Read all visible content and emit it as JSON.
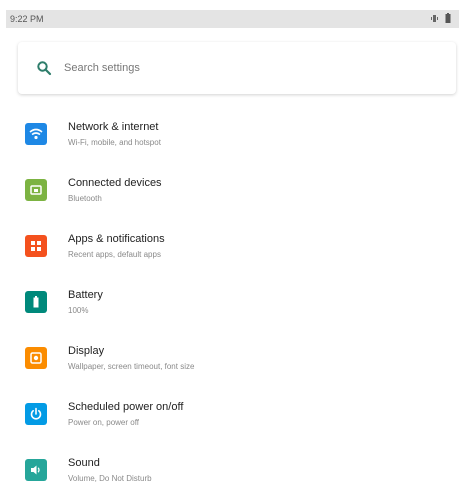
{
  "status_bar": {
    "time": "9:22 PM",
    "icons": [
      "vibrate-icon",
      "battery-icon"
    ]
  },
  "search": {
    "placeholder": "Search settings",
    "icon": "search-icon"
  },
  "settings_items": [
    {
      "title": "Network & internet",
      "subtitle": "Wi-Fi, mobile, and hotspot",
      "icon": "wifi-icon",
      "color": "#1e88e5"
    },
    {
      "title": "Connected devices",
      "subtitle": "Bluetooth",
      "icon": "devices-icon",
      "color": "#7cb342"
    },
    {
      "title": "Apps & notifications",
      "subtitle": "Recent apps, default apps",
      "icon": "apps-icon",
      "color": "#f4511e"
    },
    {
      "title": "Battery",
      "subtitle": "100%",
      "icon": "battery-icon",
      "color": "#00897b"
    },
    {
      "title": "Display",
      "subtitle": "Wallpaper, screen timeout, font size",
      "icon": "display-icon",
      "color": "#fb8c00"
    },
    {
      "title": "Scheduled power on/off",
      "subtitle": "Power on, power off",
      "icon": "power-icon",
      "color": "#039be5"
    },
    {
      "title": "Sound",
      "subtitle": "Volume, Do Not Disturb",
      "icon": "sound-icon",
      "color": "#26a69a"
    }
  ]
}
